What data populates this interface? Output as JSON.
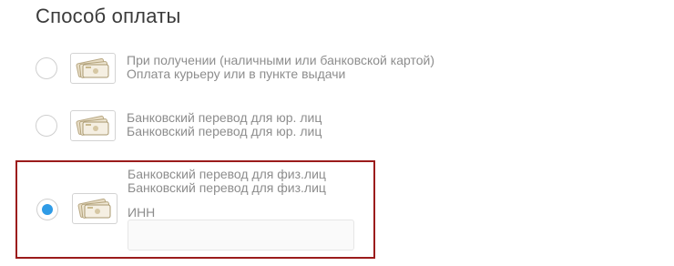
{
  "section_title": "Способ оплаты",
  "options": [
    {
      "title": "При получении (наличными или банковской картой)",
      "description": "Оплата курьеру или в пункте выдачи",
      "selected": false,
      "icon": "cash-icon"
    },
    {
      "title": "Банковский перевод для юр. лиц",
      "description": "Банковский перевод для юр. лиц",
      "selected": false,
      "icon": "cash-icon"
    },
    {
      "title": "Банковский перевод для физ.лиц",
      "description": "Банковский перевод для физ.лиц",
      "selected": true,
      "icon": "cash-icon"
    }
  ],
  "inn": {
    "label": "ИНН",
    "value": "",
    "placeholder": ""
  },
  "colors": {
    "selected_border": "#9b1c1c",
    "radio_checked": "#2f9be6"
  }
}
